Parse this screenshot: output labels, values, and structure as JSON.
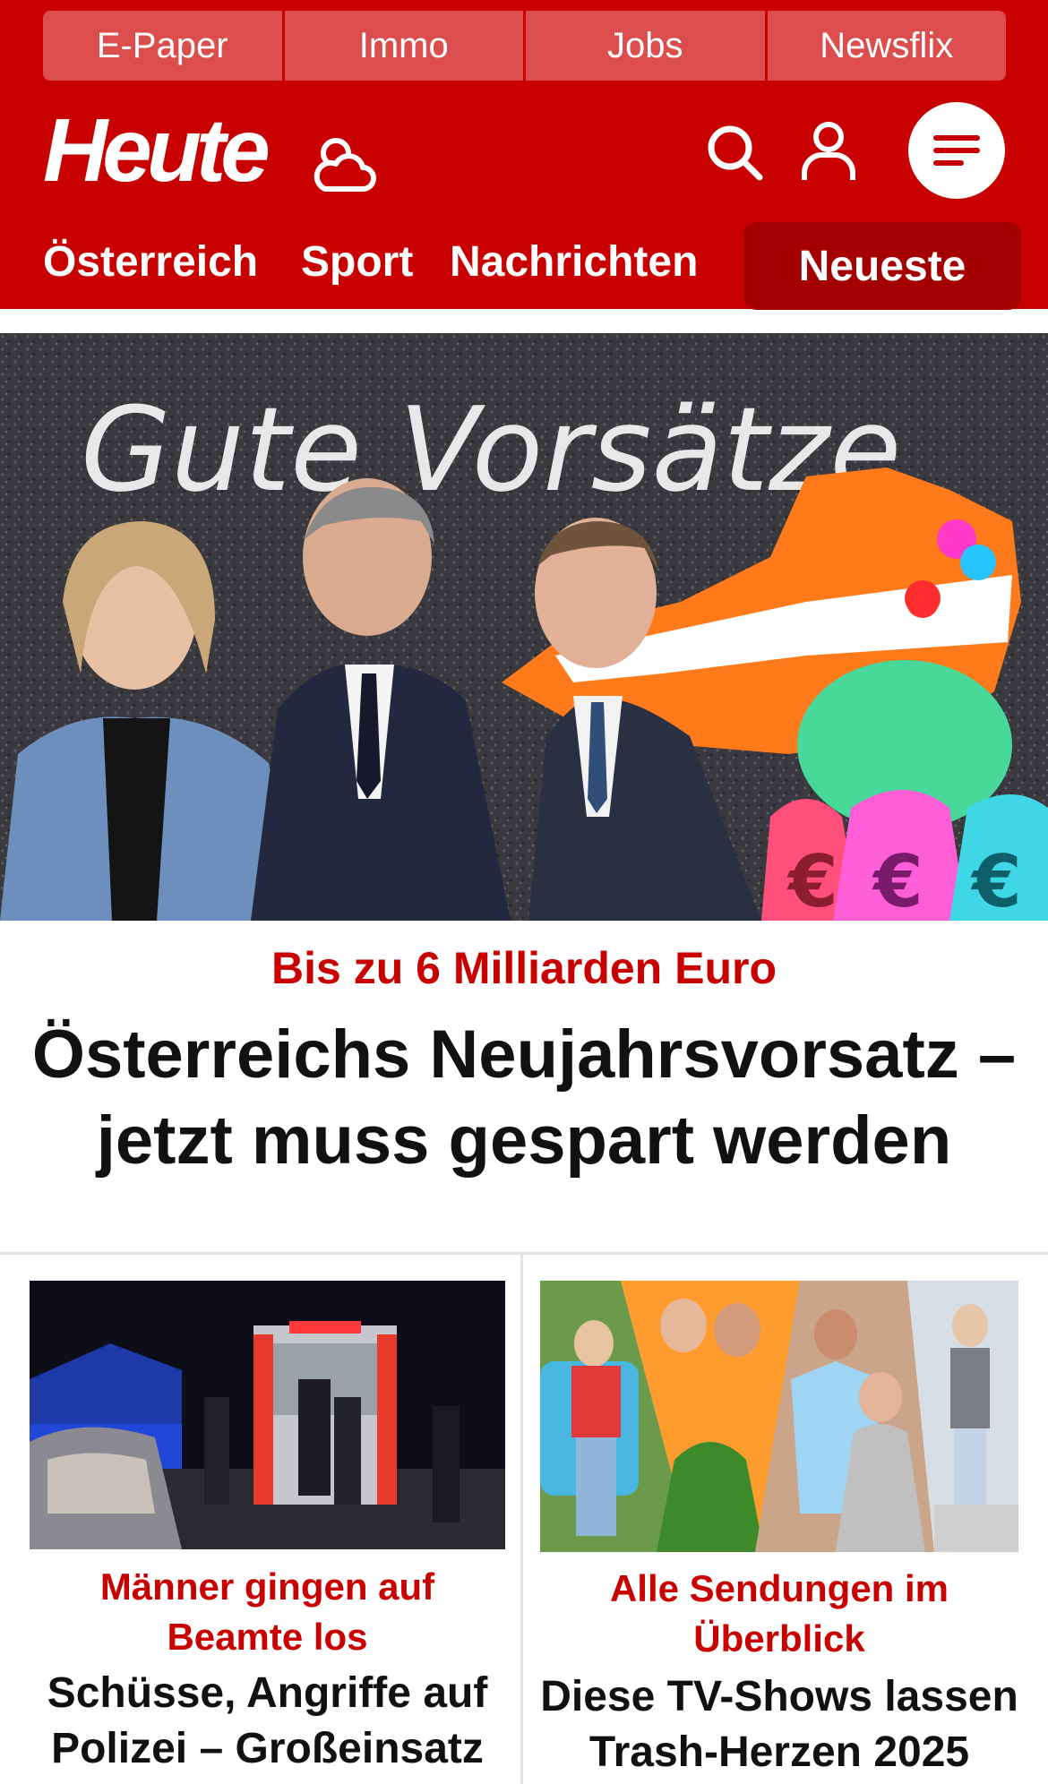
{
  "topbar": {
    "items": [
      {
        "label": "E-Paper"
      },
      {
        "label": "Immo"
      },
      {
        "label": "Jobs"
      },
      {
        "label": "Newsflix"
      }
    ]
  },
  "header": {
    "logo_text": "Heute",
    "weather_icon": "weather-cloud-sun-icon",
    "search_icon": "search-icon",
    "user_icon": "user-icon",
    "menu_icon": "menu-icon"
  },
  "nav": {
    "items": [
      {
        "label": "Österreich"
      },
      {
        "label": "Sport"
      },
      {
        "label": "Nachrichten"
      }
    ],
    "newest_label": "Neueste"
  },
  "hero": {
    "image_text": "Gute Vorsätze",
    "kicker": "Bis zu 6 Milliarden Euro",
    "title": "Österreichs Neujahrsvorsatz – jetzt muss gespart werden"
  },
  "cards": [
    {
      "kicker": "Männer gingen auf Beamte los",
      "title": "Schüsse, Angriffe auf Polizei – Großeinsatz"
    },
    {
      "kicker": "Alle Sendungen im Überblick",
      "title": "Diese TV-Shows lassen Trash-Herzen 2025"
    }
  ],
  "colors": {
    "brand_red": "#c80000",
    "topbar_red": "#dc4d4d",
    "active_tab_red": "#a50000",
    "headline_dark": "#111111"
  }
}
